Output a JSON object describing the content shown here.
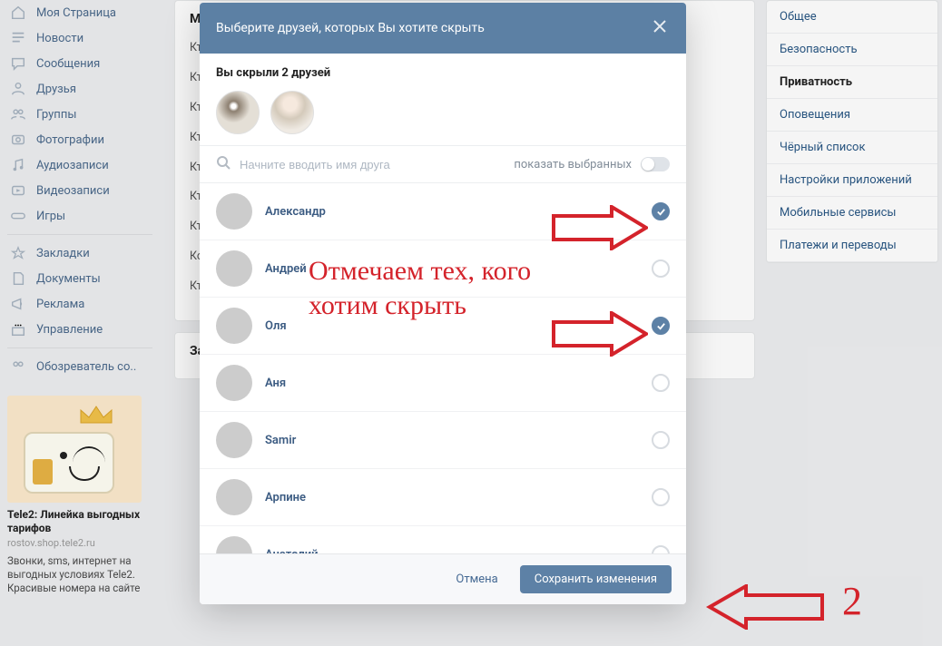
{
  "sidebar": {
    "items": [
      {
        "label": "Моя Страница",
        "icon": "home"
      },
      {
        "label": "Новости",
        "icon": "feed"
      },
      {
        "label": "Сообщения",
        "icon": "chat"
      },
      {
        "label": "Друзья",
        "icon": "friends"
      },
      {
        "label": "Группы",
        "icon": "groups"
      },
      {
        "label": "Фотографии",
        "icon": "photo"
      },
      {
        "label": "Аудиозаписи",
        "icon": "music"
      },
      {
        "label": "Видеозаписи",
        "icon": "video"
      },
      {
        "label": "Игры",
        "icon": "games"
      }
    ],
    "items2": [
      {
        "label": "Закладки",
        "icon": "star"
      },
      {
        "label": "Документы",
        "icon": "doc"
      },
      {
        "label": "Реклама",
        "icon": "adv"
      },
      {
        "label": "Управление",
        "icon": "manage"
      }
    ],
    "items3": [
      {
        "label": "Обозреватель со..",
        "icon": "people"
      }
    ]
  },
  "ad": {
    "title": "Tele2: Линейка выгодных тарифов",
    "domain": "rostov.shop.tele2.ru",
    "text": "Звонки, sms, интернет на выгодных условиях Tele2. Красивые номера на сайте"
  },
  "content": {
    "header": "М",
    "lines": [
      "Кт\nин",
      "Кт\nна",
      "Кт",
      "Кт\nсп",
      "Кт\nсп",
      "Кт\nсп",
      "Кт\nс м",
      "Ко\nмс",
      "Кт"
    ],
    "footer": "За"
  },
  "settings_tabs": [
    "Общее",
    "Безопасность",
    "Приватность",
    "Оповещения",
    "Чёрный список",
    "Настройки приложений",
    "Мобильные сервисы",
    "Платежи и переводы"
  ],
  "settings_active_index": 2,
  "modal": {
    "title": "Выберите друзей, которых Вы хотите скрыть",
    "hidden_count_text": "Вы скрыли 2 друзей",
    "search_placeholder": "Начните вводить имя друга",
    "show_selected_label": "показать выбранных",
    "cancel": "Отмена",
    "save": "Сохранить изменения",
    "friends": [
      {
        "name": "Александр",
        "checked": true,
        "cls": "avp1"
      },
      {
        "name": "Андрей",
        "checked": false,
        "cls": "avp2"
      },
      {
        "name": "Оля",
        "checked": true,
        "cls": "avp3"
      },
      {
        "name": "Аня",
        "checked": false,
        "cls": "avp4"
      },
      {
        "name": "Samir",
        "checked": false,
        "cls": "avp5"
      },
      {
        "name": "Арпине",
        "checked": false,
        "cls": "avp6"
      },
      {
        "name": "Анатолий",
        "checked": false,
        "cls": "avp7"
      }
    ]
  },
  "annotations": {
    "text": "Отмечаем тех, кого хотим скрыть",
    "marker": "2"
  }
}
